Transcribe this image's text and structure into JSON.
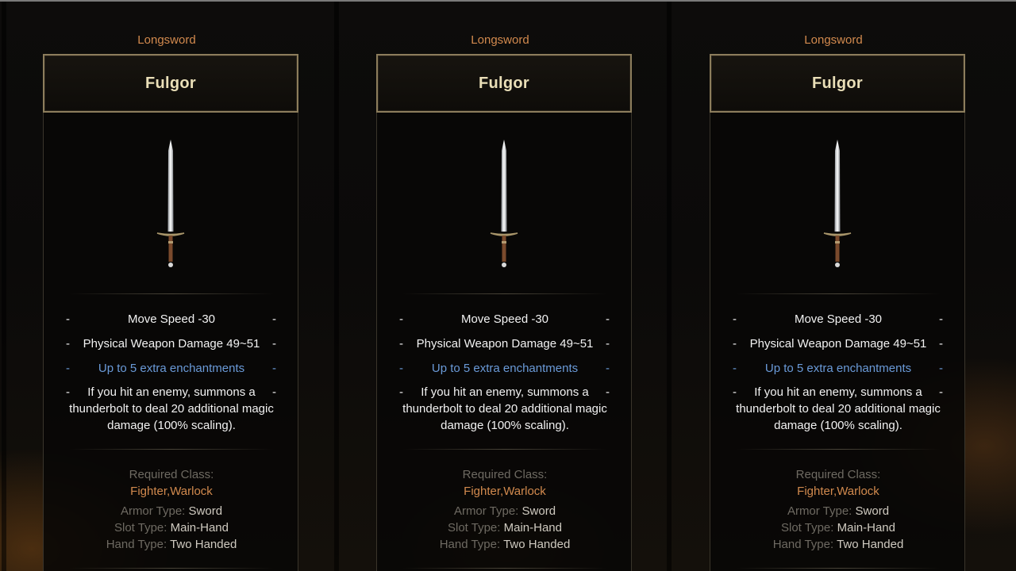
{
  "cards": [
    {
      "category": "Longsword",
      "name": "Fulgor",
      "icon": "longsword-icon",
      "stats": [
        {
          "text": "Move Speed -30",
          "color": "white"
        },
        {
          "text": "Physical Weapon Damage 49~51",
          "color": "white"
        },
        {
          "text": "Up to 5 extra enchantments",
          "color": "blue"
        },
        {
          "text": "If you hit an enemy, summons a thunderbolt to deal 20 additional magic damage (100% scaling).",
          "color": "white"
        }
      ],
      "required_class_label": "Required Class:",
      "required_class": "Fighter,Warlock",
      "armor_type_label": "Armor Type:",
      "armor_type": "Sword",
      "slot_type_label": "Slot Type:",
      "slot_type": "Main-Hand",
      "hand_type_label": "Hand Type:",
      "hand_type": "Two Handed"
    },
    {
      "category": "Longsword",
      "name": "Fulgor",
      "icon": "longsword-icon",
      "stats": [
        {
          "text": "Move Speed -30",
          "color": "white"
        },
        {
          "text": "Physical Weapon Damage 49~51",
          "color": "white"
        },
        {
          "text": "Up to 5 extra enchantments",
          "color": "blue"
        },
        {
          "text": "If you hit an enemy, summons a thunderbolt to deal 20 additional magic damage (100% scaling).",
          "color": "white"
        }
      ],
      "required_class_label": "Required Class:",
      "required_class": "Fighter,Warlock",
      "armor_type_label": "Armor Type:",
      "armor_type": "Sword",
      "slot_type_label": "Slot Type:",
      "slot_type": "Main-Hand",
      "hand_type_label": "Hand Type:",
      "hand_type": "Two Handed"
    },
    {
      "category": "Longsword",
      "name": "Fulgor",
      "icon": "longsword-icon",
      "stats": [
        {
          "text": "Move Speed -30",
          "color": "white"
        },
        {
          "text": "Physical Weapon Damage 49~51",
          "color": "white"
        },
        {
          "text": "Up to 5 extra enchantments",
          "color": "blue"
        },
        {
          "text": "If you hit an enemy, summons a thunderbolt to deal 20 additional magic damage (100% scaling).",
          "color": "white"
        }
      ],
      "required_class_label": "Required Class:",
      "required_class": "Fighter,Warlock",
      "armor_type_label": "Armor Type:",
      "armor_type": "Sword",
      "slot_type_label": "Slot Type:",
      "slot_type": "Main-Hand",
      "hand_type_label": "Hand Type:",
      "hand_type": "Two Handed"
    }
  ],
  "colors": {
    "category": "#d28a4e",
    "title": "#eadfb8",
    "title_border": "#8c7d5c",
    "stat_white": "#f2f2f2",
    "stat_blue": "#6a9ad8",
    "label_gray": "#6e6a62",
    "value_light": "#cfcac0"
  }
}
